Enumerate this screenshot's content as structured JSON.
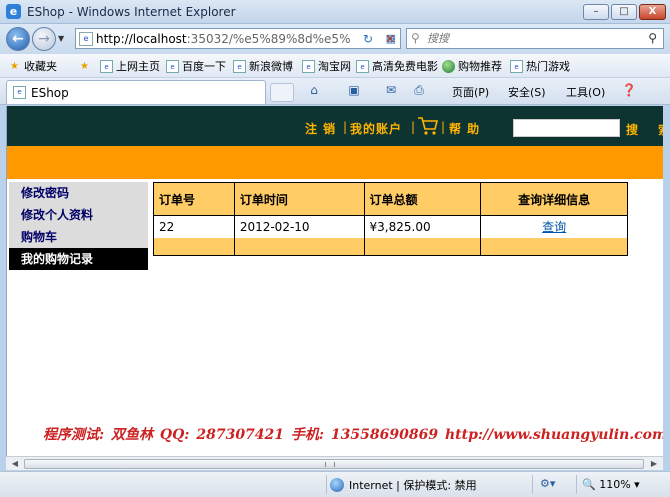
{
  "window": {
    "title": "EShop - Windows Internet Explorer",
    "minimize_label": "–",
    "maximize_label": "□",
    "close_label": "X"
  },
  "address": {
    "url_host": "http://localhost",
    "url_rest": ":35032/%e5%89%8d%e5%",
    "search_placeholder": "搜搜"
  },
  "favorites": {
    "label": "收藏夹",
    "items": [
      "上网主页",
      "百度一下",
      "新浪微博",
      "淘宝网",
      "高清免费电影",
      "购物推荐",
      "热门游戏"
    ]
  },
  "tab": {
    "label": "EShop"
  },
  "command_bar": {
    "page": "页面(P)",
    "safety": "安全(S)",
    "tools": "工具(O)"
  },
  "site": {
    "header": {
      "logout": "注 销",
      "separator": "|",
      "my_account": "我的账户",
      "help": "帮 助",
      "search_button": "搜 索"
    },
    "left_nav": [
      {
        "label": "修改密码",
        "active": false
      },
      {
        "label": "修改个人资料",
        "active": false
      },
      {
        "label": "购物车",
        "active": false
      },
      {
        "label": "我的购物记录",
        "active": true
      }
    ],
    "orders_table": {
      "columns": [
        "订单号",
        "订单时间",
        "订单总额",
        "查询详细信息"
      ],
      "rows": [
        {
          "order_id": "22",
          "order_time": "2012-02-10",
          "total": "¥3,825.00",
          "detail_link": "查询"
        }
      ]
    },
    "credits": "程序测试: 双鱼林    QQ: 287307421    手机: 13558690869    http://www.shuangyulin.com"
  },
  "status": {
    "zone": "Internet | 保护模式: 禁用",
    "zoom": "110%"
  },
  "colors": {
    "header_bg": "#0e3432",
    "accent_orange": "#ff9900",
    "table_header": "#ffcc66",
    "credits_red": "#cc2222"
  }
}
